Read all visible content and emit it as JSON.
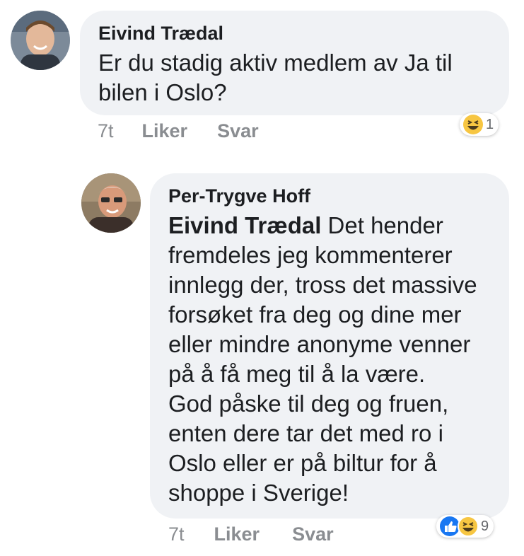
{
  "comments": [
    {
      "author": "Eivind Trædal",
      "text": "Er du stadig aktiv medlem av Ja til bilen i Oslo?",
      "time": "7t",
      "like_label": "Liker",
      "reply_label": "Svar",
      "reaction_count": "1",
      "reactions": [
        "haha-icon"
      ]
    },
    {
      "author": "Per-Trygve Hoff",
      "mention": "Eivind Trædal",
      "text_lines": [
        " Det hender",
        "fremdeles jeg kommenterer",
        "innlegg der, tross det massive",
        "forsøket fra deg og dine mer",
        "eller mindre anonyme venner",
        "på å få meg til å la være.",
        "God påske til deg og fruen,",
        "enten dere tar det med ro i",
        "Oslo eller er på biltur for å",
        "shoppe i Sverige!"
      ],
      "time": "7t",
      "like_label": "Liker",
      "reply_label": "Svar",
      "reaction_count": "9",
      "reactions": [
        "like-icon",
        "haha-icon"
      ]
    }
  ],
  "colors": {
    "bubble": "#f0f2f5",
    "meta": "#8a8d91",
    "like_blue": "#1877f2",
    "haha_yellow": "#f7c642"
  }
}
